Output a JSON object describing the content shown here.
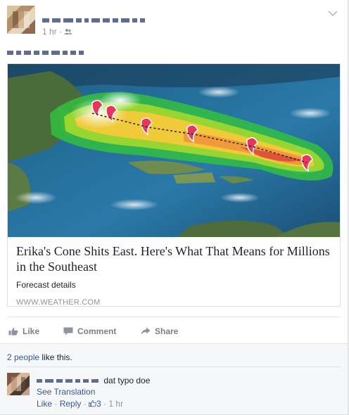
{
  "post": {
    "timestamp": "1 hr",
    "meta_separator": "·",
    "audience_icon": "friends-icon"
  },
  "link_preview": {
    "title": "Erika's Cone Shits East. Here's What That Means for Millions in the Southeast",
    "description": "Forecast details",
    "domain": "WWW.WEATHER.COM"
  },
  "actions": {
    "like": "Like",
    "comment": "Comment",
    "share": "Share"
  },
  "feedback": {
    "likes_count_link": "2 people",
    "likes_suffix": " like this."
  },
  "comment": {
    "text": "dat typo doe",
    "see_translation": "See Translation",
    "like": "Like",
    "sep": " · ",
    "reply": "Reply",
    "like_count": "3",
    "time": "1 hr"
  },
  "colors": {
    "link": "#365899",
    "muted": "#90949c",
    "action": "#7f7f7f"
  }
}
